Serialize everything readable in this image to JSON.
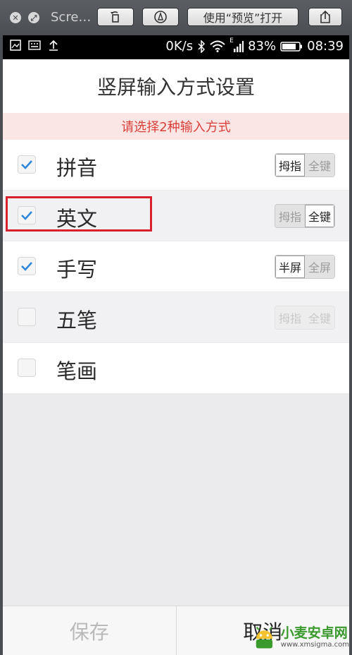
{
  "toolbar": {
    "title": "Scre…",
    "open_with_label": "使用“预览”打开"
  },
  "statusbar": {
    "speed": "0K/s",
    "network": "E",
    "battery": "83%",
    "time": "08:39"
  },
  "header": {
    "title": "竖屏输入方式设置"
  },
  "notice": {
    "text": "请选择2种输入方式"
  },
  "rows": [
    {
      "label": "拼音",
      "checked": true,
      "options": [
        "拇指",
        "全键"
      ],
      "active": 0
    },
    {
      "label": "英文",
      "checked": true,
      "options": [
        "拇指",
        "全键"
      ],
      "active": 1
    },
    {
      "label": "手写",
      "checked": true,
      "options": [
        "半屏",
        "全屏"
      ],
      "active": 0
    },
    {
      "label": "五笔",
      "checked": false,
      "options": [
        "拇指",
        "全键"
      ],
      "active": -1
    },
    {
      "label": "笔画",
      "checked": false,
      "options": [],
      "active": -1
    }
  ],
  "footer": {
    "save_label": "保存",
    "cancel_label": "取消"
  },
  "watermark": {
    "title": "小麦安卓网",
    "url": "www.xmsigma.com"
  },
  "colors": {
    "accent_check": "#2f87d8",
    "notice_text": "#d9403a",
    "highlight_border": "#d8212c"
  }
}
